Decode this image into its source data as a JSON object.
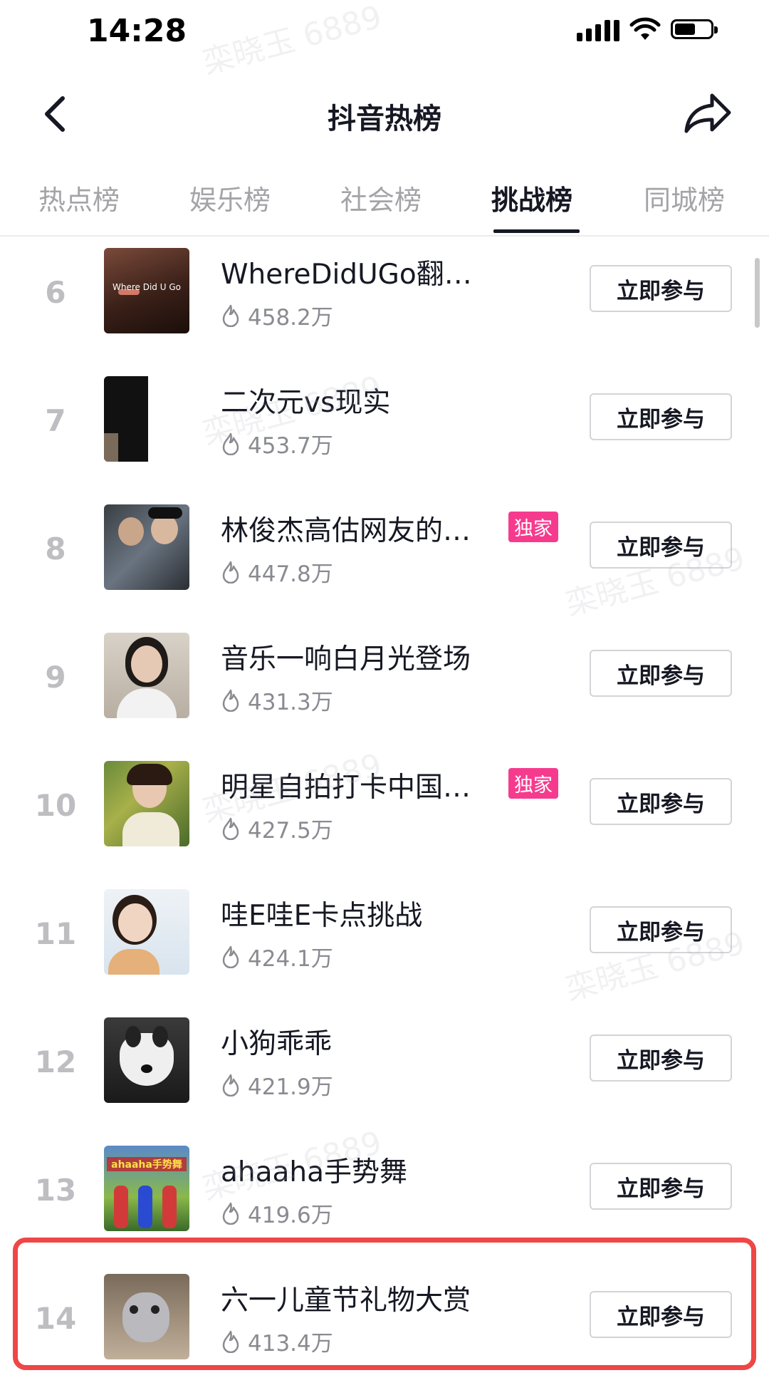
{
  "status": {
    "time": "14:28"
  },
  "nav": {
    "title": "抖音热榜"
  },
  "tabs": [
    "热点榜",
    "娱乐榜",
    "社会榜",
    "挑战榜",
    "同城榜"
  ],
  "active_tab": "挑战榜",
  "action_label": "立即参与",
  "watermark": "栾晓玉 6889",
  "rows": [
    {
      "rank": "6",
      "title": "WhereDidUGo翻唱挑战",
      "heat": "458.2万",
      "badge": ""
    },
    {
      "rank": "7",
      "title": "二次元vs现实",
      "heat": "453.7万",
      "badge": ""
    },
    {
      "rank": "8",
      "title": "林俊杰高估网友的…",
      "heat": "447.8万",
      "badge": "独家"
    },
    {
      "rank": "9",
      "title": "音乐一响白月光登场",
      "heat": "431.3万",
      "badge": ""
    },
    {
      "rank": "10",
      "title": "明星自拍打卡中国…",
      "heat": "427.5万",
      "badge": "独家"
    },
    {
      "rank": "11",
      "title": "哇E哇E卡点挑战",
      "heat": "424.1万",
      "badge": ""
    },
    {
      "rank": "12",
      "title": "小狗乖乖",
      "heat": "421.9万",
      "badge": ""
    },
    {
      "rank": "13",
      "title": "ahaaha手势舞",
      "heat": "419.6万",
      "badge": ""
    },
    {
      "rank": "14",
      "title": "六一儿童节礼物大赏",
      "heat": "413.4万",
      "badge": ""
    }
  ],
  "thumb_texts": {
    "t6": "Where Did U Go",
    "t13": "ahaaha手势舞"
  },
  "colors": {
    "accent_badge": "#f63b8e",
    "highlight": "#ef4646"
  }
}
